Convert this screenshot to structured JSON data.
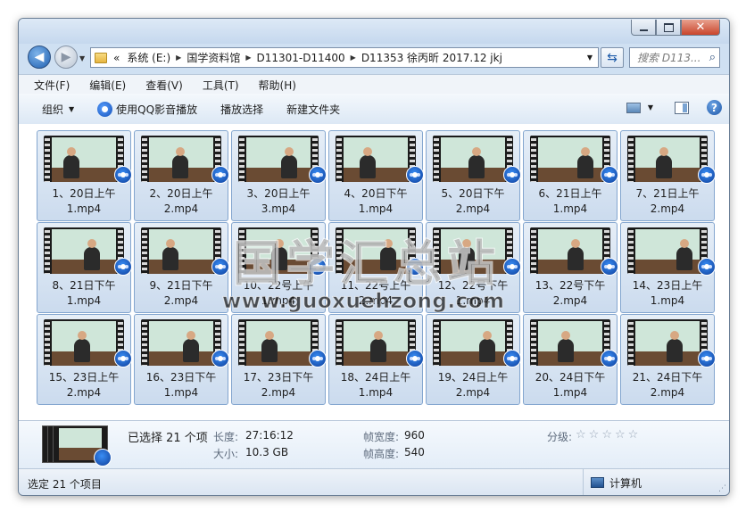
{
  "address": {
    "crumbs": [
      "系统 (E:)",
      "国学资料馆",
      "D11301-D11400",
      "D11353 徐丙昕 2017.12 jkj"
    ],
    "lead": "«"
  },
  "search": {
    "placeholder": "搜索 D113..."
  },
  "menu": [
    "文件(F)",
    "编辑(E)",
    "查看(V)",
    "工具(T)",
    "帮助(H)"
  ],
  "toolbar": {
    "organize": "组织",
    "play_qq": "使用QQ影音播放",
    "play_selection": "播放选择",
    "new_folder": "新建文件夹"
  },
  "files": [
    [
      "1、20日上午",
      "1.mp4"
    ],
    [
      "2、20日上午",
      "2.mp4"
    ],
    [
      "3、20日上午",
      "3.mp4"
    ],
    [
      "4、20日下午",
      "1.mp4"
    ],
    [
      "5、20日下午",
      "2.mp4"
    ],
    [
      "6、21日上午",
      "1.mp4"
    ],
    [
      "7、21日上午",
      "2.mp4"
    ],
    [
      "8、21日下午",
      "1.mp4"
    ],
    [
      "9、21日下午",
      "2.mp4"
    ],
    [
      "10、22号上午",
      "1.mp4"
    ],
    [
      "11、22号上午",
      "2.mp4"
    ],
    [
      "12、22号下午",
      "1.mp4"
    ],
    [
      "13、22号下午",
      "2.mp4"
    ],
    [
      "14、23日上午",
      "1.mp4"
    ],
    [
      "15、23日上午",
      "2.mp4"
    ],
    [
      "16、23日下午",
      "1.mp4"
    ],
    [
      "17、23日下午",
      "2.mp4"
    ],
    [
      "18、24日上午",
      "1.mp4"
    ],
    [
      "19、24日上午",
      "2.mp4"
    ],
    [
      "20、24日下午",
      "1.mp4"
    ],
    [
      "21、24日下午",
      "2.mp4"
    ]
  ],
  "watermark": {
    "cn": "国学汇总站",
    "url": "www.guoxuehzong.com"
  },
  "details": {
    "selected": "已选择 21 个项",
    "length_label": "长度:",
    "length_value": "27:16:12",
    "size_label": "大小:",
    "size_value": "10.3 GB",
    "width_label": "帧宽度:",
    "width_value": "960",
    "height_label": "帧高度:",
    "height_value": "540",
    "rating_label": "分级:"
  },
  "status": {
    "left": "选定 21 个项目",
    "right": "计算机"
  }
}
